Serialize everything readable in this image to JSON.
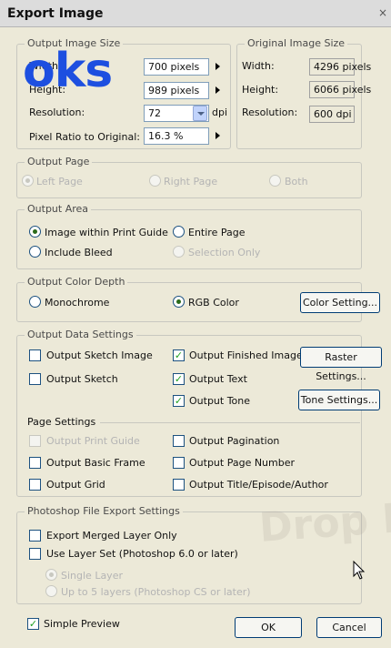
{
  "window": {
    "title": "Export Image",
    "close_label": "×"
  },
  "overlay": {
    "text": "oks"
  },
  "watermark": {
    "text": "Drop Bo"
  },
  "output_image_size": {
    "title": "Output Image Size",
    "width_label": "Width:",
    "width_value": "700 pixels",
    "height_label": "Height:",
    "height_value": "989 pixels",
    "resolution_label": "Resolution:",
    "resolution_value": "72",
    "resolution_unit": "dpi",
    "pixel_ratio_label": "Pixel Ratio to Original:",
    "pixel_ratio_value": "16.3 %"
  },
  "original_image_size": {
    "title": "Original Image Size",
    "width_label": "Width:",
    "width_value": "4296 pixels",
    "height_label": "Height:",
    "height_value": "6066 pixels",
    "resolution_label": "Resolution:",
    "resolution_value": "600 dpi"
  },
  "output_page": {
    "title": "Output Page",
    "left": "Left Page",
    "right": "Right Page",
    "both": "Both"
  },
  "output_area": {
    "title": "Output Area",
    "within_guide": "Image within Print Guide",
    "entire_page": "Entire Page",
    "include_bleed": "Include Bleed",
    "selection_only": "Selection Only"
  },
  "output_color_depth": {
    "title": "Output Color Depth",
    "monochrome": "Monochrome",
    "rgb": "RGB Color",
    "color_setting_button": "Color Setting..."
  },
  "output_data_settings": {
    "title": "Output Data Settings",
    "sketch_image": "Output Sketch Image",
    "finished_image": "Output Finished Image",
    "raster_settings_button": "Raster Settings...",
    "sketch": "Output Sketch",
    "text": "Output Text",
    "tone": "Output Tone",
    "tone_settings_button": "Tone Settings...",
    "page_settings_title": "Page Settings",
    "print_guide": "Output Print Guide",
    "pagination": "Output Pagination",
    "basic_frame": "Output Basic Frame",
    "page_number": "Output Page Number",
    "grid": "Output Grid",
    "title_episode": "Output Title/Episode/Author"
  },
  "photoshop": {
    "title": "Photoshop File Export Settings",
    "merged": "Export Merged Layer Only",
    "layer_set": "Use Layer Set (Photoshop 6.0 or later)",
    "single_layer": "Single Layer",
    "up_to_5": "Up to 5 layers (Photoshop CS or later)"
  },
  "footer": {
    "simple_preview": "Simple Preview",
    "ok_button": "OK",
    "cancel_button": "Cancel"
  }
}
